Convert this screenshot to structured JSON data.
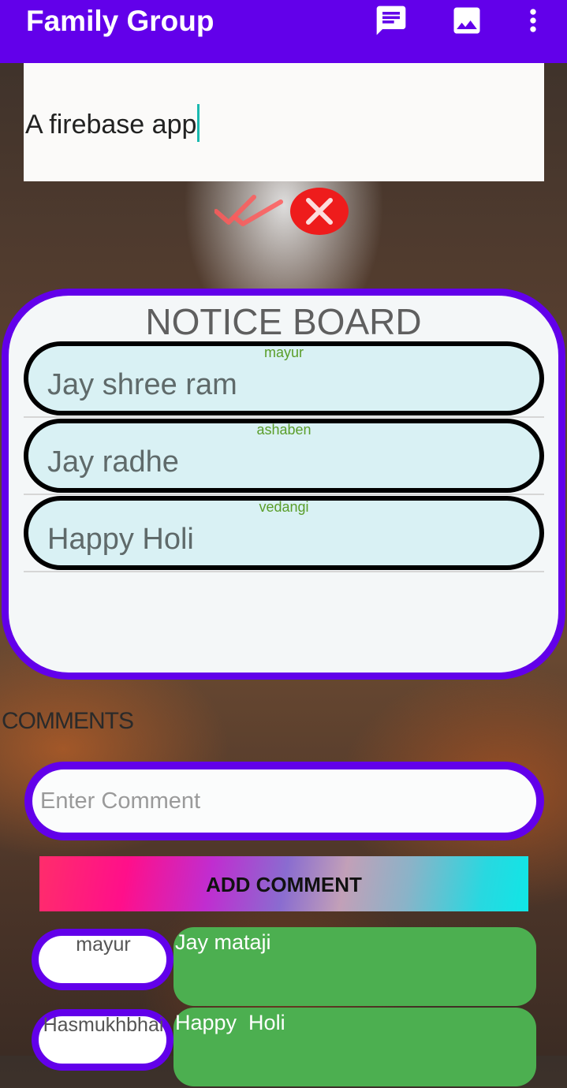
{
  "app_bar": {
    "title": "Family Group",
    "icons": [
      "chat-icon",
      "image-icon",
      "more-vert-icon"
    ],
    "color": "#6200ea"
  },
  "notice_input": {
    "value": "A firebase app"
  },
  "actions": {
    "confirm_icon": "double-check-icon",
    "cancel_icon": "cancel-circle-icon"
  },
  "notice_board": {
    "title": "NOTICE BOARD",
    "items": [
      {
        "author": "mayur",
        "text": "Jay shree ram"
      },
      {
        "author": "ashaben",
        "text": "Jay radhe"
      },
      {
        "author": "vedangi",
        "text": "Happy Holi"
      }
    ]
  },
  "comments": {
    "label": "COMMENTS",
    "input_placeholder": "Enter Comment",
    "add_button_label": "ADD COMMENT",
    "items": [
      {
        "author": "mayur",
        "text": "Jay mataji"
      },
      {
        "author": "Hasmukhbhai",
        "text": "Happy  Holi"
      }
    ]
  }
}
